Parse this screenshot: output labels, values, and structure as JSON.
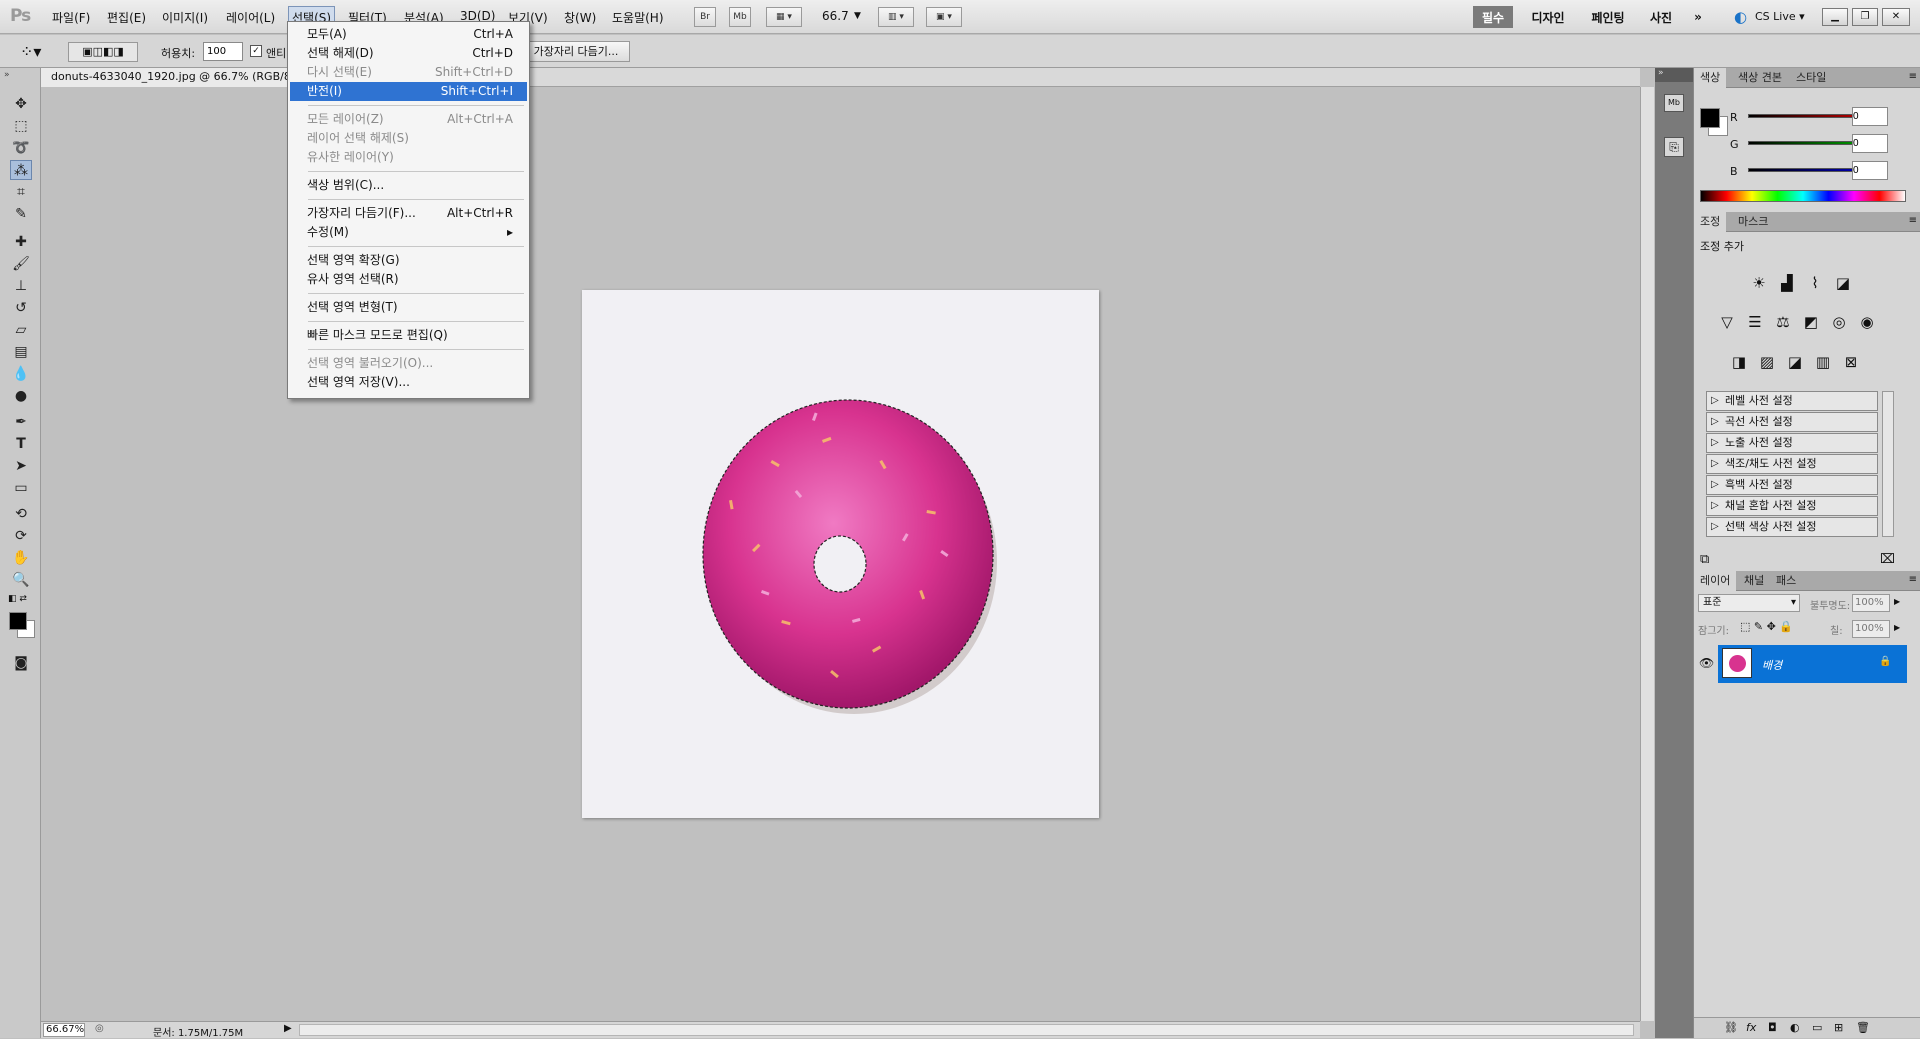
{
  "app": {
    "logo": "Ps"
  },
  "menubar": {
    "items": [
      "파일(F)",
      "편집(E)",
      "이미지(I)",
      "레이어(L)",
      "선택(S)",
      "필터(T)",
      "분석(A)",
      "3D(D)",
      "보기(V)",
      "창(W)",
      "도움말(H)"
    ],
    "br_label": "Br",
    "mb_label": "Mb",
    "zoom_value": "66.7",
    "workspaces": [
      "필수",
      "디자인",
      "페인팅",
      "사진"
    ],
    "cslive": "CS Live"
  },
  "options": {
    "tolerance_label": "허용치:",
    "tolerance_value": "100",
    "antialias_label": "앤티",
    "refine_edge_label": "가장자리 다듬기..."
  },
  "document": {
    "tab_title": "donuts-4633040_1920.jpg @ 66.7% (RGB/8",
    "status_zoom": "66.67%",
    "status_doc": "문서: 1.75M/1.75M"
  },
  "select_menu": {
    "items": [
      {
        "label": "모두(A)",
        "shortcut": "Ctrl+A",
        "disabled": false,
        "highlighted": false
      },
      {
        "label": "선택 해제(D)",
        "shortcut": "Ctrl+D",
        "disabled": false,
        "highlighted": false
      },
      {
        "label": "다시 선택(E)",
        "shortcut": "Shift+Ctrl+D",
        "disabled": true,
        "highlighted": false
      },
      {
        "label": "반전(I)",
        "shortcut": "Shift+Ctrl+I",
        "disabled": false,
        "highlighted": true
      },
      {
        "label": "모든 레이어(Z)",
        "shortcut": "Alt+Ctrl+A",
        "disabled": true,
        "highlighted": false
      },
      {
        "label": "레이어 선택 해제(S)",
        "shortcut": "",
        "disabled": true,
        "highlighted": false
      },
      {
        "label": "유사한 레이어(Y)",
        "shortcut": "",
        "disabled": true,
        "highlighted": false
      },
      {
        "label": "색상 범위(C)...",
        "shortcut": "",
        "disabled": false,
        "highlighted": false
      },
      {
        "label": "가장자리 다듬기(F)...",
        "shortcut": "Alt+Ctrl+R",
        "disabled": false,
        "highlighted": false
      },
      {
        "label": "수정(M)",
        "shortcut": "▸",
        "disabled": false,
        "highlighted": false
      },
      {
        "label": "선택 영역 확장(G)",
        "shortcut": "",
        "disabled": false,
        "highlighted": false
      },
      {
        "label": "유사 영역 선택(R)",
        "shortcut": "",
        "disabled": false,
        "highlighted": false
      },
      {
        "label": "선택 영역 변형(T)",
        "shortcut": "",
        "disabled": false,
        "highlighted": false
      },
      {
        "label": "빠른 마스크 모드로 편집(Q)",
        "shortcut": "",
        "disabled": false,
        "highlighted": false
      },
      {
        "label": "선택 영역 불러오기(O)...",
        "shortcut": "",
        "disabled": true,
        "highlighted": false
      },
      {
        "label": "선택 영역 저장(V)...",
        "shortcut": "",
        "disabled": false,
        "highlighted": false
      }
    ]
  },
  "color_panel": {
    "tabs": [
      "색상",
      "색상 견본",
      "스타일"
    ],
    "r_label": "R",
    "r_value": "0",
    "g_label": "G",
    "g_value": "0",
    "b_label": "B",
    "b_value": "0",
    "accent_r": "#d40000",
    "accent_g": "#00b000",
    "accent_b": "#0000d0"
  },
  "adjust_panel": {
    "tabs": [
      "조정",
      "마스크"
    ],
    "title": "조정 추가",
    "presets": [
      "레벨 사전 설정",
      "곡선 사전 설정",
      "노출 사전 설정",
      "색조/채도 사전 설정",
      "흑백 사전 설정",
      "채널 혼합 사전 설정",
      "선택 색상 사전 설정"
    ]
  },
  "layers_panel": {
    "tabs": [
      "레이어",
      "채널",
      "패스"
    ],
    "blend_mode": "표준",
    "opacity_label": "불투명도:",
    "opacity_value": "100%",
    "lock_label": "잠그기:",
    "fill_label": "칠:",
    "fill_value": "100%",
    "layer_name": "배경",
    "layer_highlight": "#0a72d6"
  },
  "colors": {
    "donut": "#d8338f",
    "paper": "#f1f0f4"
  }
}
